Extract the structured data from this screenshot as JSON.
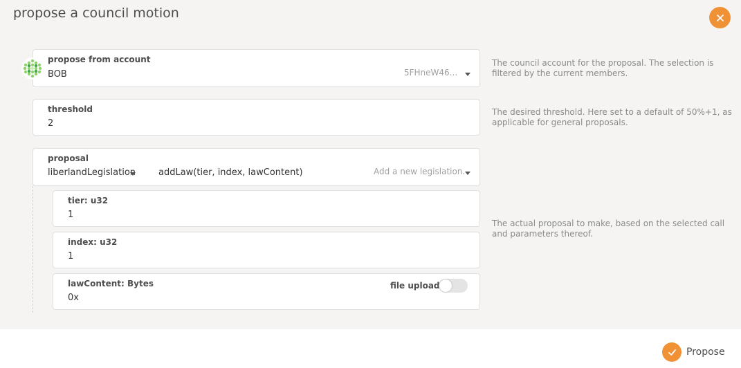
{
  "modal": {
    "title": "propose a council motion",
    "close_icon": "close-icon"
  },
  "account": {
    "label": "propose from account",
    "name": "BOB",
    "address": "5FHneW46...",
    "help": "The council account for the proposal. The selection is filtered by the current members."
  },
  "threshold": {
    "label": "threshold",
    "value": "2",
    "help": "The desired threshold. Here set to a default of 50%+1, as applicable for general proposals."
  },
  "proposal": {
    "label": "proposal",
    "section": "liberlandLegislation",
    "method": "addLaw(tier, index, lawContent)",
    "method_doc": "Add a new legislation.",
    "help": "The actual proposal to make, based on the selected call and parameters thereof.",
    "params": {
      "tier": {
        "label": "tier: u32",
        "value": "1"
      },
      "index": {
        "label": "index: u32",
        "value": "1"
      },
      "lawContent": {
        "label": "lawContent: Bytes",
        "value": "0x",
        "toggle_label": "file upload",
        "toggle_on": false
      }
    }
  },
  "actions": {
    "propose_label": "Propose",
    "propose_icon": "check-icon"
  },
  "colors": {
    "accent": "#f19135",
    "modal_bg": "#f5f4f3",
    "field_border": "#dfdfdf"
  }
}
